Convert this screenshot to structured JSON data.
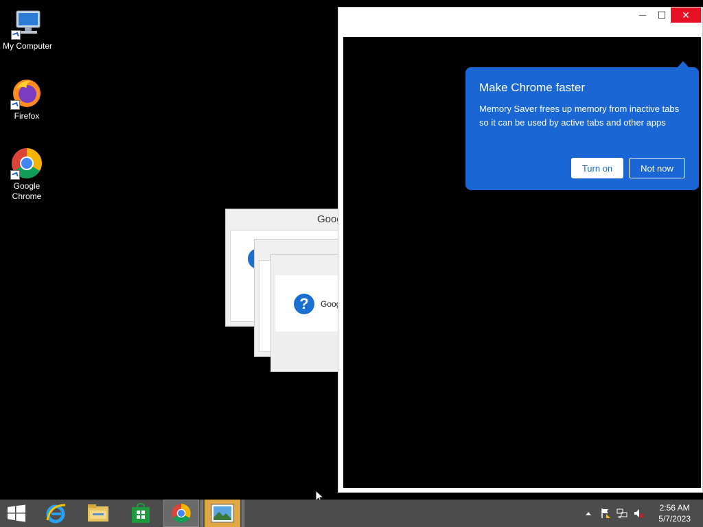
{
  "desktop": {
    "icons": [
      {
        "label": "My Computer",
        "icon": "computer-icon"
      },
      {
        "label": "Firefox",
        "icon": "firefox-icon"
      },
      {
        "label": "Google\nChrome",
        "icon": "chrome-icon"
      }
    ]
  },
  "dialogs": {
    "back_title": "Goog",
    "front_text": "Goog",
    "icon": "question-icon",
    "icon_glyph": "?"
  },
  "chrome_window": {
    "minimize_glyph": "—",
    "maximize_glyph": "☐",
    "close_glyph": "✕"
  },
  "bubble": {
    "title": "Make Chrome faster",
    "body": "Memory Saver frees up memory from inactive tabs so it can be used by active tabs and other apps",
    "turn_on_label": "Turn on",
    "not_now_label": "Not now",
    "color": "#1a66d4"
  },
  "taskbar": {
    "items": [
      "start-icon",
      "internet-explorer-icon",
      "file-explorer-icon",
      "store-icon",
      "chrome-icon",
      "photos-icon"
    ],
    "tray": [
      "show-hidden-icons-icon",
      "action-center-flag-icon",
      "network-icon",
      "volume-muted-icon"
    ],
    "time": "2:56 AM",
    "date": "5/7/2023"
  }
}
